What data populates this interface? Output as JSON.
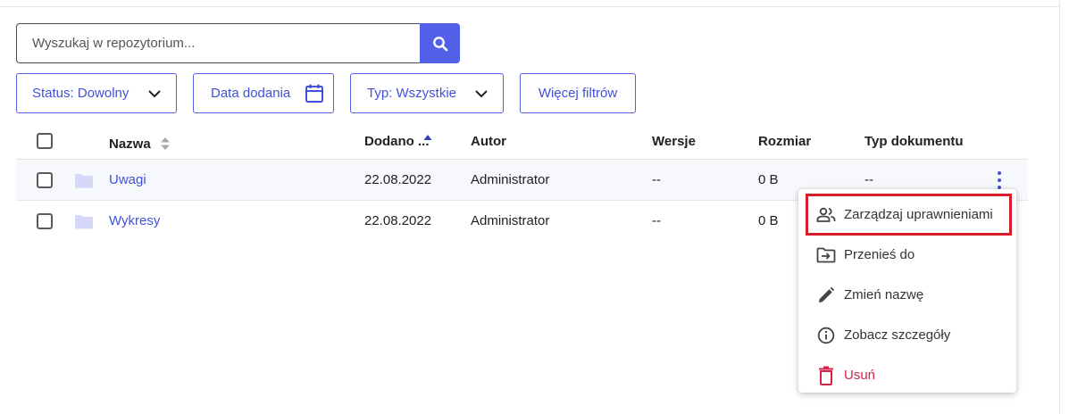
{
  "search": {
    "placeholder": "Wyszukaj w repozytorium...",
    "value": ""
  },
  "filters": {
    "status": "Status: Dowolny",
    "date": "Data dodania",
    "type": "Typ: Wszystkie",
    "more": "Więcej filtrów"
  },
  "table": {
    "columns": {
      "name": "Nazwa",
      "added": "Dodano ...",
      "author": "Autor",
      "versions": "Wersje",
      "size": "Rozmiar",
      "doc_type": "Typ dokumentu"
    },
    "rows": [
      {
        "name": "Uwagi",
        "added": "22.08.2022",
        "author": "Administrator",
        "versions": "--",
        "size": "0 B",
        "doc_type": "--"
      },
      {
        "name": "Wykresy",
        "added": "22.08.2022",
        "author": "Administrator",
        "versions": "--",
        "size": "0 B",
        "doc_type": ""
      }
    ]
  },
  "context_menu": {
    "items": [
      {
        "label": "Zarządzaj uprawnieniami",
        "icon": "people-icon"
      },
      {
        "label": "Przenieś do",
        "icon": "folder-move-icon"
      },
      {
        "label": "Zmień nazwę",
        "icon": "pencil-icon"
      },
      {
        "label": "Zobacz szczegóły",
        "icon": "info-icon"
      },
      {
        "label": "Usuń",
        "icon": "trash-icon"
      }
    ]
  },
  "colors": {
    "accent": "#5160e6",
    "link": "#3f51d9",
    "danger": "#d6234a",
    "highlight": "#d81c2a"
  }
}
